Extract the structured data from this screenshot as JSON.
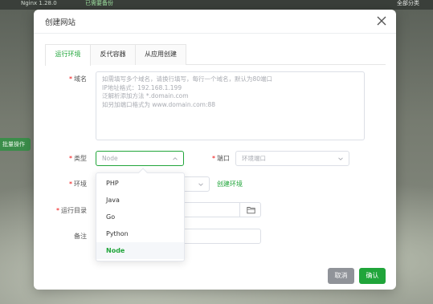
{
  "background": {
    "tag_a": "Nginx 1.28.0",
    "tag_b": "已需要备份",
    "tag_c": "全部分类",
    "side_badge": "批量操作"
  },
  "modal": {
    "title": "创建网站",
    "tabs": [
      {
        "label": "运行环境",
        "active": true
      },
      {
        "label": "反代容器",
        "active": false
      },
      {
        "label": "从应用创建",
        "active": false
      }
    ],
    "fields": {
      "domain_label": "域名",
      "domain_placeholder": "如需填写多个域名，请换行填写，每行一个域名，默认为80端口\nIP地址格式：192.168.1.199\n泛解析添加方法 *.domain.com\n如另加端口格式为 www.domain.com:88",
      "type_label": "类型",
      "type_value": "Node",
      "port_label": "端口",
      "port_placeholder": "环境端口",
      "env_label": "环境",
      "create_env_link": "创建环境",
      "run_dir_label": "运行目录",
      "remark_label": "备注"
    },
    "type_options": [
      "PHP",
      "Java",
      "Go",
      "Python",
      "Node"
    ],
    "selected_type": "Node",
    "buttons": {
      "cancel": "取消",
      "confirm": "确认"
    }
  },
  "colors": {
    "accent": "#20a53a",
    "required": "#ef0808",
    "cancel_bg": "#909399"
  }
}
